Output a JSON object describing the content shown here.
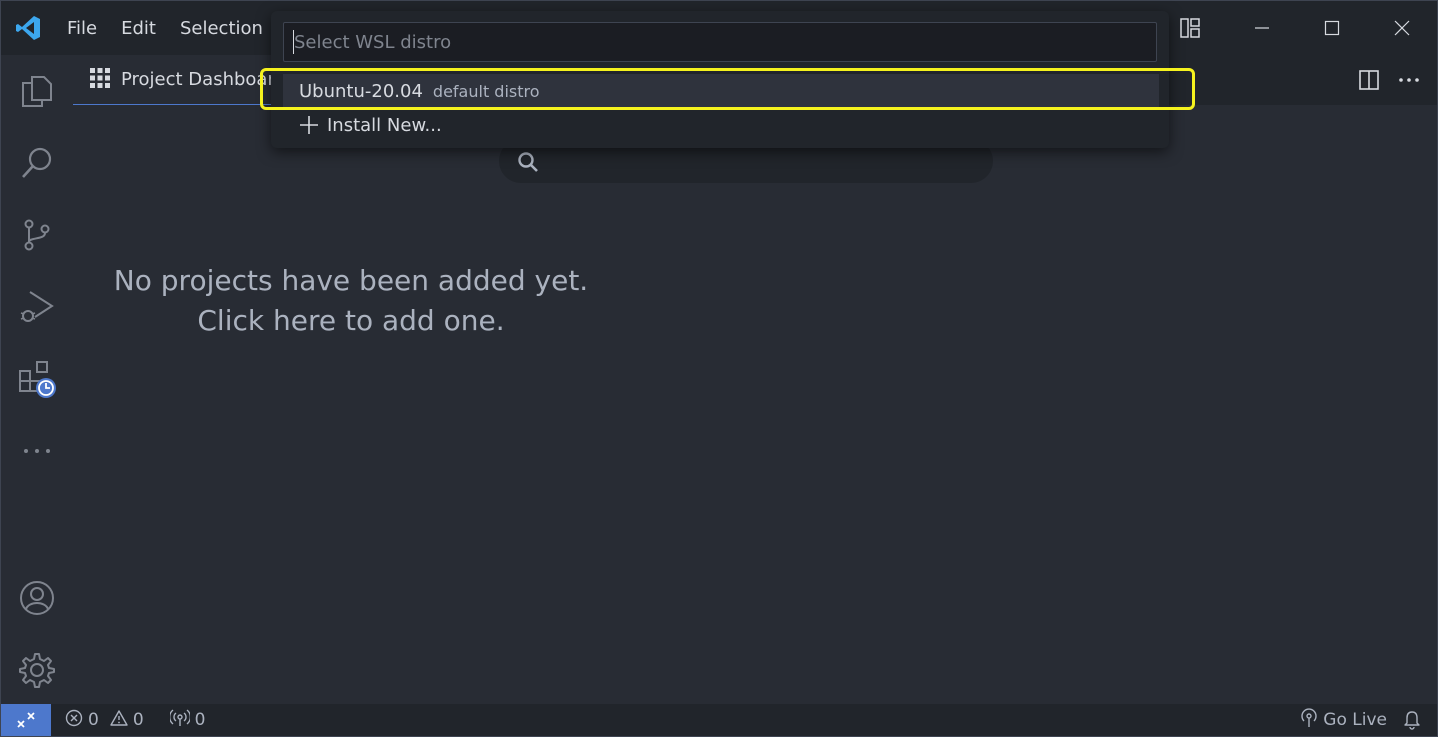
{
  "menu": {
    "file": "File",
    "edit": "Edit",
    "selection": "Selection"
  },
  "tab": {
    "label": "Project Dashboard",
    "icon": "grid-icon"
  },
  "quickpick": {
    "placeholder": "Select WSL distro",
    "value": "",
    "items": [
      {
        "label": "Ubuntu-20.04",
        "description": "default distro"
      },
      {
        "label": "Install New...",
        "icon": "plus-icon"
      }
    ]
  },
  "dashboard": {
    "empty_line1": "No projects have been added yet.",
    "empty_line2": "Click here to add one."
  },
  "statusbar": {
    "errors": "0",
    "warnings": "0",
    "ports": "0",
    "go_live": "Go Live"
  },
  "colors": {
    "accent": "#4d78cc",
    "highlight": "#f5f21e",
    "background": "#282c34",
    "panel": "#21252b"
  }
}
